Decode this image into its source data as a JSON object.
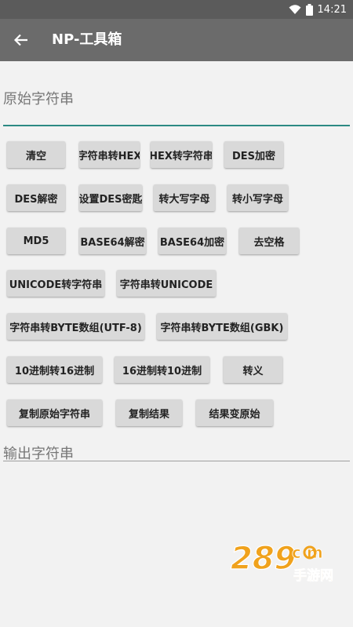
{
  "status": {
    "time": "14:21"
  },
  "appbar": {
    "title": "NP-工具箱"
  },
  "input": {
    "label": "原始字符串"
  },
  "buttons": {
    "clear": "清空",
    "str_to_hex": "字符串转HEX",
    "hex_to_str": "HEX转字符串",
    "des_encrypt": "DES加密",
    "des_decrypt": "DES解密",
    "set_des_key": "设置DES密匙",
    "to_upper": "转大写字母",
    "to_lower": "转小写字母",
    "md5": "MD5",
    "base64_decode": "BASE64解密",
    "base64_encode": "BASE64加密",
    "trim_spaces": "去空格",
    "unicode_to_str": "UNICODE转字符串",
    "str_to_unicode": "字符串转UNICODE",
    "str_to_byte_utf8": "字符串转BYTE数组(UTF-8)",
    "str_to_byte_gbk": "字符串转BYTE数组(GBK)",
    "dec_to_hex": "10进制转16进制",
    "hex_to_dec": "16进制转10进制",
    "escape": "转义",
    "copy_original": "复制原始字符串",
    "copy_result": "复制结果",
    "result_to_original": "结果变原始"
  },
  "output": {
    "label": "输出字符串"
  },
  "watermark": {
    "logo_text": "289",
    "domain": "c m",
    "subtitle": "手游网"
  },
  "colors": {
    "accent": "#2c8a83",
    "appbar": "#6b6b6b",
    "statusbar": "#5b5b5b",
    "button": "#d9d9d9",
    "watermark": "#f0a21c"
  }
}
